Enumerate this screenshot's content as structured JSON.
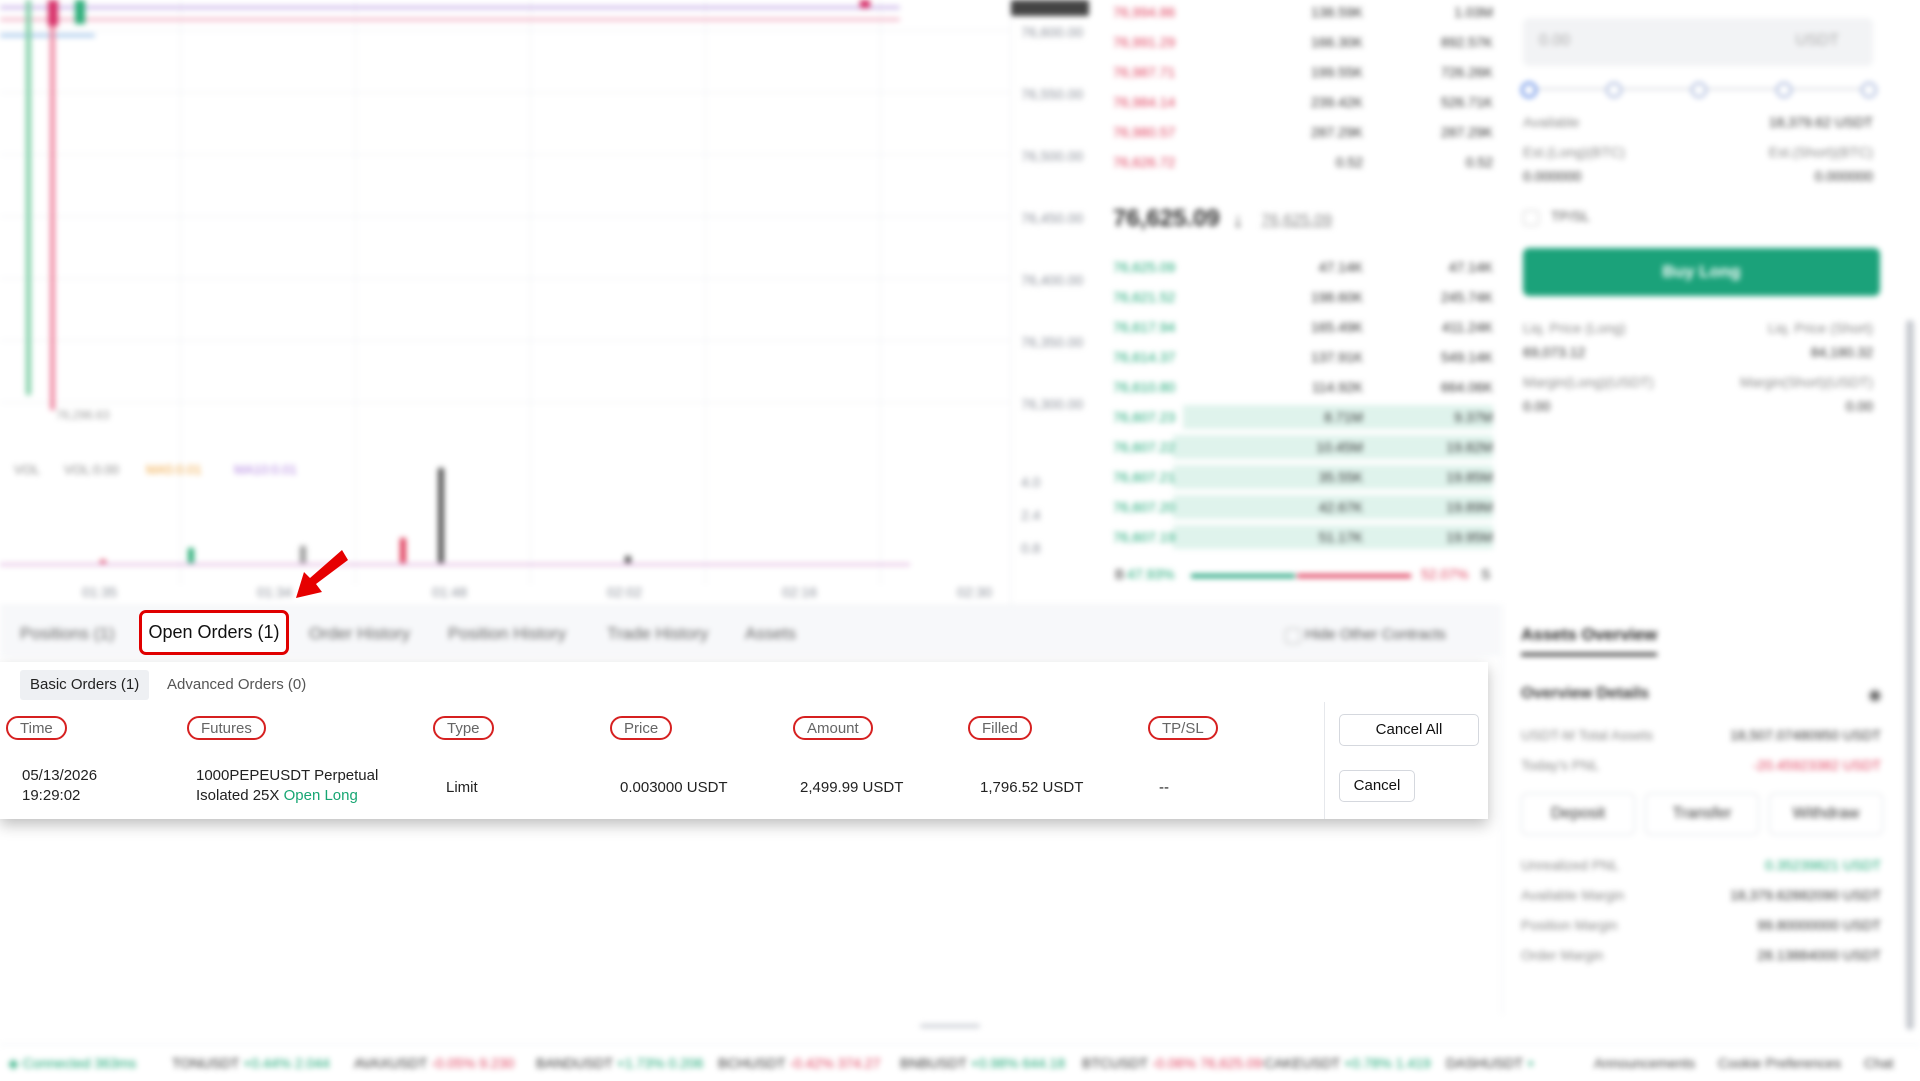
{
  "chart": {
    "price_axis": [
      "76,600.00",
      "76,550.00",
      "76,500.00",
      "76,450.00",
      "76,400.00",
      "76,350.00",
      "76,300.00"
    ],
    "low_marker": "76,296.63",
    "volume_axis": [
      "4.0",
      "2.4",
      "0.8"
    ],
    "volume_legend": {
      "vol": "VOL",
      "vol_value": "VOL:0.00",
      "ma5": "MA5:0.01",
      "ma10": "MA10:0.01"
    },
    "time_axis": [
      "01:35",
      "01:34",
      "01:48",
      "02:02",
      "02:16",
      "02:30"
    ]
  },
  "orderbook": {
    "asks": [
      {
        "price": "76,994.86",
        "amount": "138.59K",
        "total": "1.03M"
      },
      {
        "price": "76,991.29",
        "amount": "166.30K",
        "total": "892.57K"
      },
      {
        "price": "76,987.71",
        "amount": "199.55K",
        "total": "726.26K"
      },
      {
        "price": "76,984.14",
        "amount": "239.42K",
        "total": "526.71K"
      },
      {
        "price": "76,980.57",
        "amount": "287.29K",
        "total": "287.29K"
      },
      {
        "price": "76,626.72",
        "amount": "0.52",
        "total": "0.52"
      }
    ],
    "last_price": "76,625.09",
    "mark_price": "76,625.09",
    "bids": [
      {
        "price": "76,625.09",
        "amount": "47.14K",
        "total": "47.14K"
      },
      {
        "price": "76,621.52",
        "amount": "198.60K",
        "total": "245.74K"
      },
      {
        "price": "76,617.94",
        "amount": "165.49K",
        "total": "411.24K"
      },
      {
        "price": "76,614.37",
        "amount": "137.91K",
        "total": "549.14K"
      },
      {
        "price": "76,610.80",
        "amount": "114.92K",
        "total": "664.06K"
      },
      {
        "price": "76,607.23",
        "amount": "8.71M",
        "total": "9.37M"
      },
      {
        "price": "76,607.22",
        "amount": "10.45M",
        "total": "19.82M"
      },
      {
        "price": "76,607.21",
        "amount": "35.55K",
        "total": "19.85M"
      },
      {
        "price": "76,607.20",
        "amount": "42.67K",
        "total": "19.89M"
      },
      {
        "price": "76,607.19",
        "amount": "51.17K",
        "total": "19.95M"
      }
    ],
    "buy_ratio": "47.93%",
    "sell_ratio": "52.07%",
    "buy_label": "B",
    "sell_label": "S"
  },
  "order_form": {
    "amount_placeholder": "0.00",
    "amount_unit": "USDT",
    "available_label": "Available",
    "available_value": "18,379.62 USDT",
    "est_long": "Est.(Long)(BTC)",
    "est_short": "Est.(Short)(BTC)",
    "est_long_value": "0.000000",
    "est_short_value": "0.000000",
    "tpsl": "TP/SL",
    "buy_long": "Buy Long",
    "liq_long": "Liq. Price (Long)",
    "liq_short": "Liq. Price (Short)",
    "liq_long_value": "69,073.12",
    "liq_short_value": "84,180.32",
    "margin_long": "Margin(Long)(USDT)",
    "margin_short": "Margin(Short)(USDT)",
    "margin_long_value": "0.00",
    "margin_short_value": "0.00"
  },
  "bottom_tabs": {
    "positions": "Positions (1)",
    "open_orders": "Open Orders (1)",
    "order_history": "Order History",
    "position_history": "Position History",
    "trade_history": "Trade History",
    "assets": "Assets",
    "hide_other": "Hide Other Contracts"
  },
  "open_orders": {
    "basic_tab": "Basic Orders (1)",
    "advanced_tab": "Advanced Orders (0)",
    "columns": {
      "time": "Time",
      "futures": "Futures",
      "type": "Type",
      "price": "Price",
      "amount": "Amount",
      "filled": "Filled",
      "tpsl": "TP/SL"
    },
    "cancel_all": "Cancel All",
    "rows": [
      {
        "date": "05/13/2026",
        "time": "19:29:02",
        "futures": "1000PEPEUSDT Perpetual",
        "mode": "Isolated",
        "leverage": "25X",
        "side": "Open Long",
        "type": "Limit",
        "price": "0.003000 USDT",
        "amount": "2,499.99 USDT",
        "filled": "1,796.52 USDT",
        "tpsl": "--",
        "cancel": "Cancel"
      }
    ]
  },
  "assets_overview": {
    "title": "Assets Overview",
    "details": "Overview Details",
    "total_label": "USDT-M Total Assets",
    "total_value": "18,507.07480950 USDT",
    "pnl_label": "Today's PNL",
    "pnl_value": "-20.45923382 USDT",
    "deposit": "Deposit",
    "transfer": "Transfer",
    "withdraw": "Withdraw",
    "upnl_label": "Unrealized PNL",
    "upnl_value": "0.35239821 USDT",
    "avail_label": "Available Margin",
    "avail_value": "18,379.62882090 USDT",
    "pos_label": "Position Margin",
    "pos_value": "99.80000000 USDT",
    "ord_label": "Order Margin",
    "ord_value": "28.13884000 USDT"
  },
  "status_bar": {
    "connection": "Connected 363ms",
    "tickers": [
      {
        "symbol": "TONUSDT",
        "change": "+0.44%",
        "price": "2.044",
        "color": "#17a673"
      },
      {
        "symbol": "AVAXUSDT",
        "change": "-0.05%",
        "price": "9.230",
        "color": "#e0405e"
      },
      {
        "symbol": "BANDUSDT",
        "change": "+1.73%",
        "price": "0.206",
        "color": "#17a673"
      },
      {
        "symbol": "BCHUSDT",
        "change": "-0.42%",
        "price": "374.27",
        "color": "#e0405e"
      },
      {
        "symbol": "BNBUSDT",
        "change": "+0.98%",
        "price": "644.18",
        "color": "#17a673"
      },
      {
        "symbol": "BTCUSDT",
        "change": "-0.06%",
        "price": "76,625.09",
        "color": "#e0405e"
      },
      {
        "symbol": "CAKEUSDT",
        "change": "+0.78%",
        "price": "1.419",
        "color": "#17a673"
      },
      {
        "symbol": "DASHUSDT",
        "change": "+",
        "price": "",
        "color": "#17a673"
      }
    ],
    "announcements": "Announcements",
    "cookie": "Cookie Preferences",
    "chat": "Chat"
  },
  "colors": {
    "buy_green": "#17a673",
    "sell_red": "#e0405e",
    "highlight_red": "#e00000"
  }
}
